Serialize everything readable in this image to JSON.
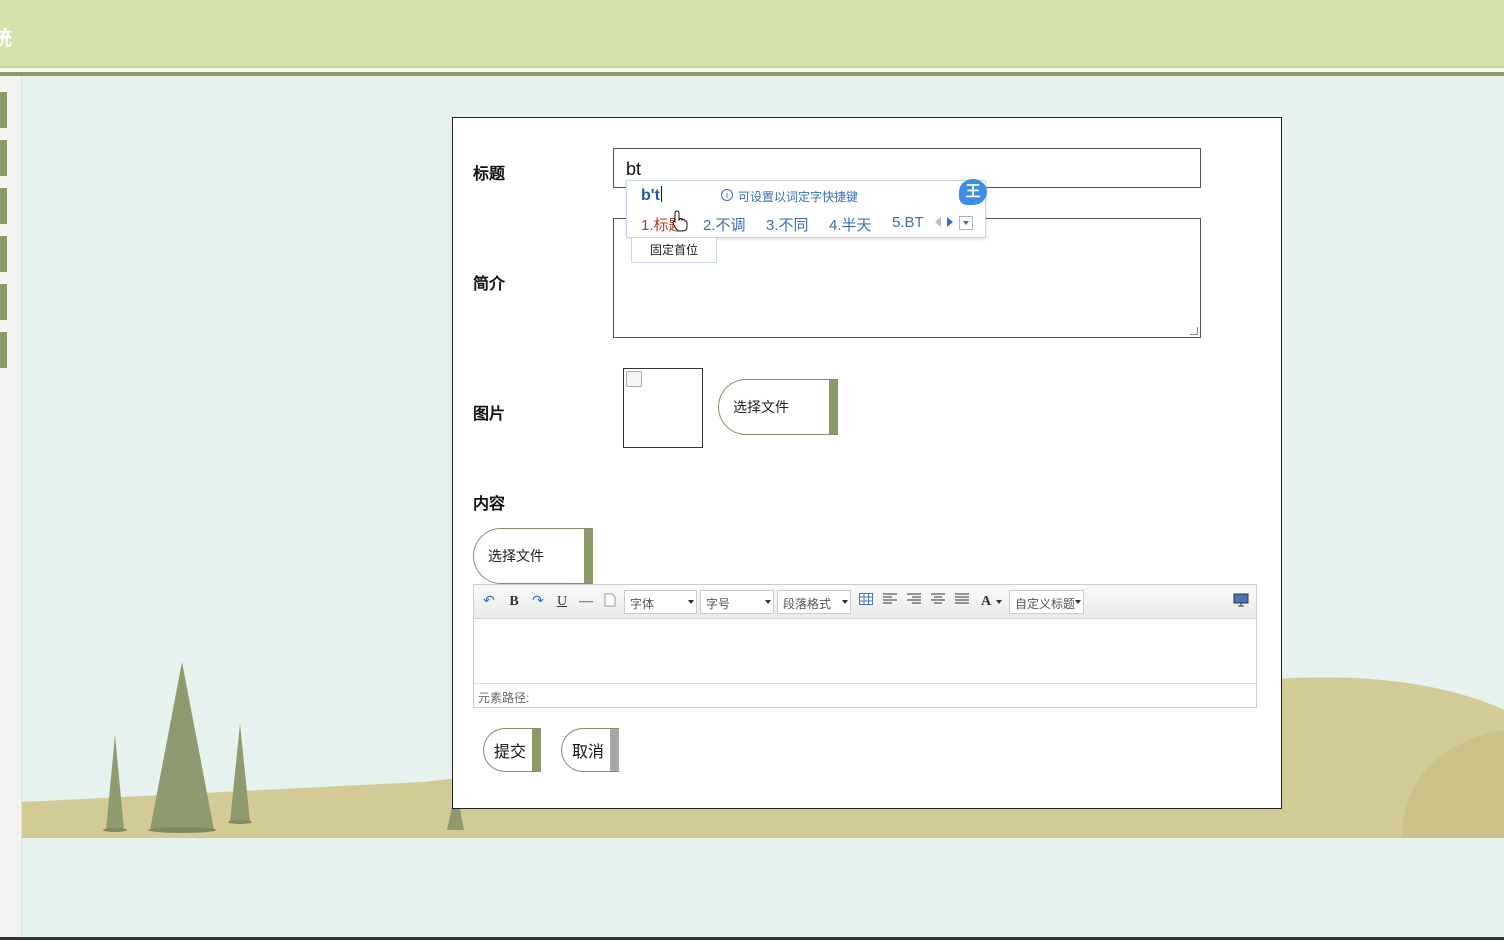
{
  "header": {
    "title_fragment": "统"
  },
  "form": {
    "title_label": "标题",
    "title_value": "bt",
    "intro_label": "简介",
    "image_label": "图片",
    "image_choose_button": "选择文件",
    "content_label": "内容",
    "content_choose_button": "选择文件",
    "submit_button": "提交",
    "cancel_button": "取消"
  },
  "editor": {
    "font_select": "字体",
    "size_select": "字号",
    "paragraph_select": "段落格式",
    "custom_title_select": "自定义标题",
    "status_path": "元素路径:",
    "icons": [
      "undo-icon",
      "bold-icon",
      "redo-icon",
      "underline-icon",
      "horizontal-rule-icon",
      "page-icon",
      "table-icon",
      "align-left-icon",
      "align-right-icon",
      "align-center-icon",
      "justify-icon",
      "font-color-icon",
      "preview-icon"
    ]
  },
  "ime": {
    "composition": "b't",
    "hint": "可设置以词定字快捷键",
    "logo": "王",
    "candidates": [
      "1.标题",
      "2.不调",
      "3.不同",
      "4.半天",
      "5.BT"
    ],
    "pin_label": "固定首位"
  },
  "colors": {
    "header_bg": "#d3e3aa",
    "accent_olive": "#8c9a6a",
    "page_bg": "#e6f2ee",
    "hill": "#d3cb96"
  }
}
